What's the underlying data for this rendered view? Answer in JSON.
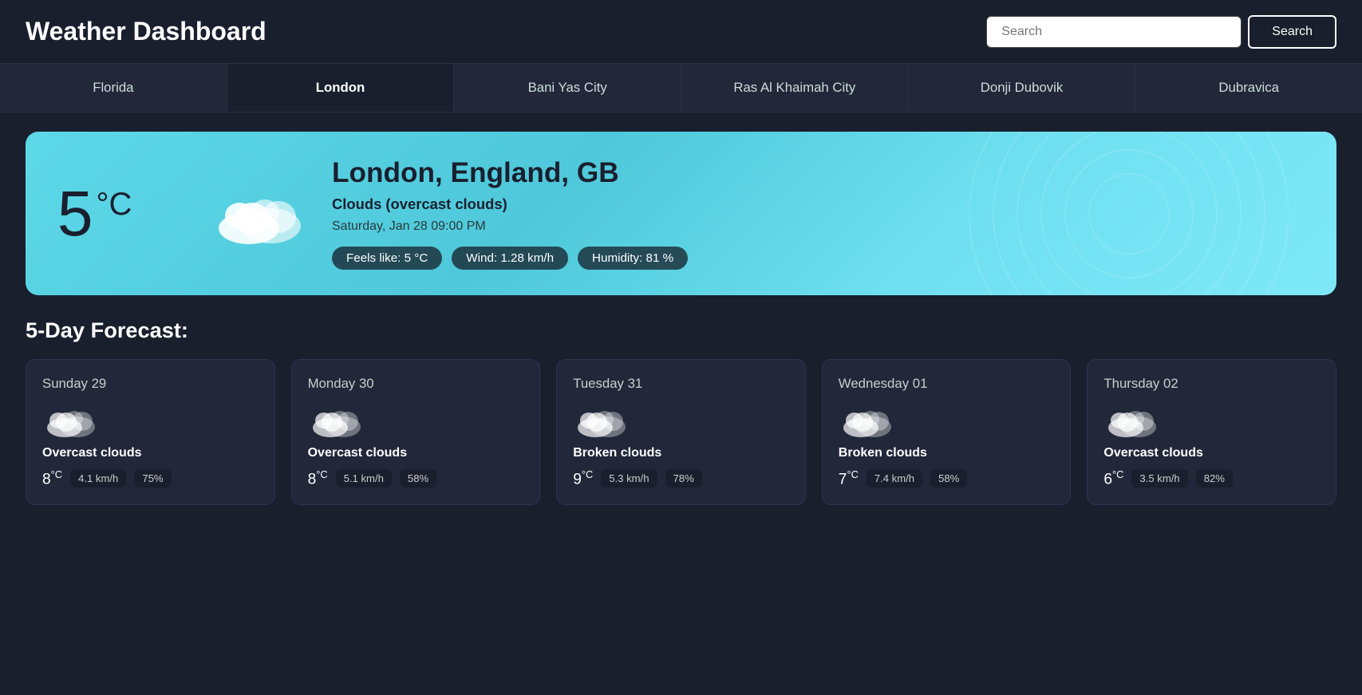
{
  "header": {
    "title": "Weather Dashboard",
    "search_placeholder": "Search",
    "search_button": "Search"
  },
  "tabs": [
    {
      "label": "Florida",
      "active": false
    },
    {
      "label": "London",
      "active": true
    },
    {
      "label": "Bani Yas City",
      "active": false
    },
    {
      "label": "Ras Al Khaimah City",
      "active": false
    },
    {
      "label": "Donji Dubovik",
      "active": false
    },
    {
      "label": "Dubravica",
      "active": false
    }
  ],
  "current_weather": {
    "city": "London, England, GB",
    "condition": "Clouds (overcast clouds)",
    "date": "Saturday, Jan 28 09:00 PM",
    "temp": "5",
    "temp_unit": "°C",
    "feels_like": "Feels like: 5 °C",
    "wind": "Wind: 1.28 km/h",
    "humidity": "Humidity: 81 %"
  },
  "forecast_title": "5-Day Forecast:",
  "forecast": [
    {
      "day": "Sunday 29",
      "condition": "Overcast clouds",
      "temp": "8",
      "wind": "4.1 km/h",
      "humidity": "75%"
    },
    {
      "day": "Monday 30",
      "condition": "Overcast clouds",
      "temp": "8",
      "wind": "5.1 km/h",
      "humidity": "58%"
    },
    {
      "day": "Tuesday 31",
      "condition": "Broken clouds",
      "temp": "9",
      "wind": "5.3 km/h",
      "humidity": "78%"
    },
    {
      "day": "Wednesday 01",
      "condition": "Broken clouds",
      "temp": "7",
      "wind": "7.4 km/h",
      "humidity": "58%"
    },
    {
      "day": "Thursday 02",
      "condition": "Overcast clouds",
      "temp": "6",
      "wind": "3.5 km/h",
      "humidity": "82%"
    }
  ]
}
